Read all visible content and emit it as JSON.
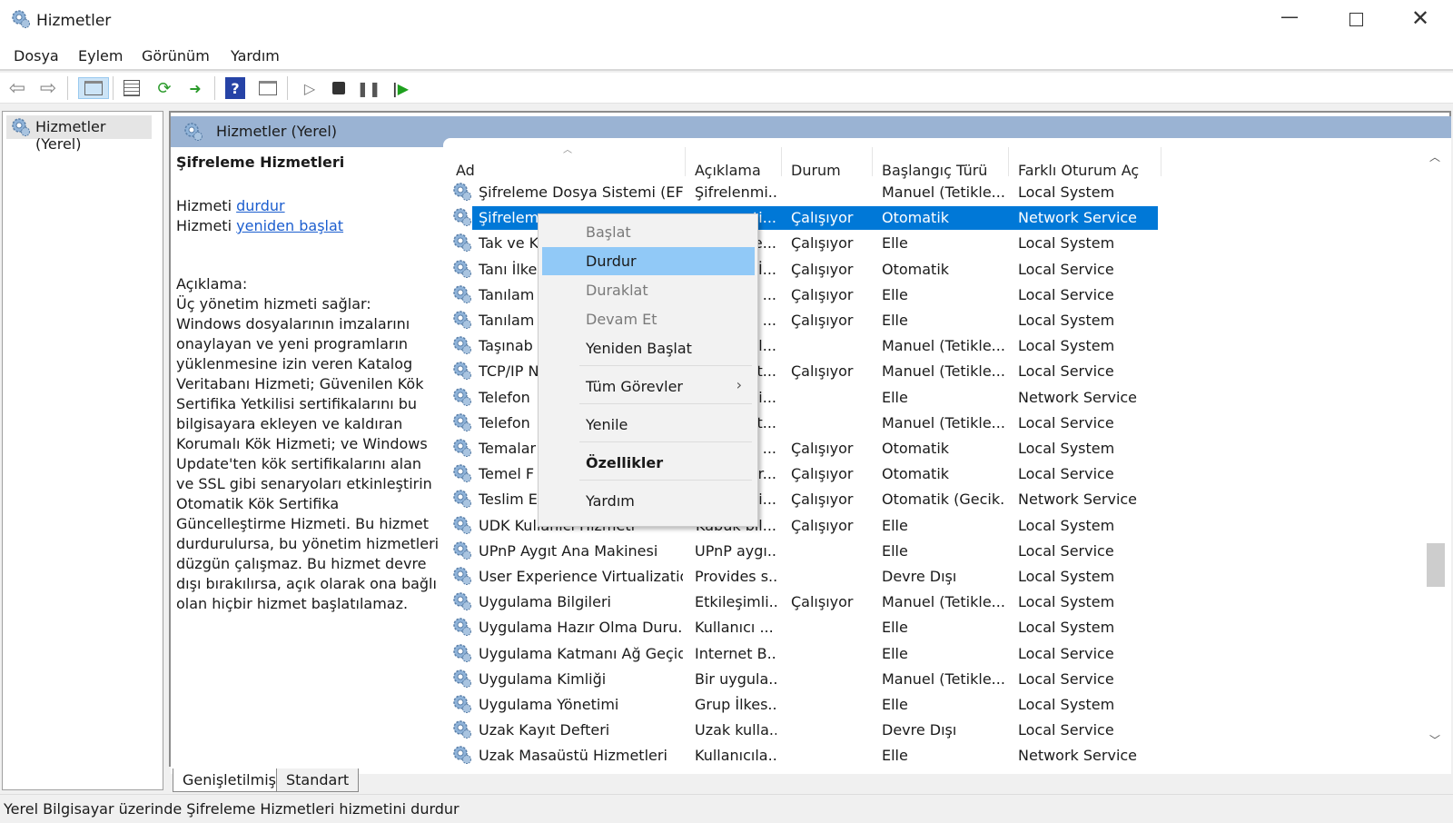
{
  "window": {
    "title": "Hizmetler",
    "icon": "gear-icon"
  },
  "menu": [
    "Dosya",
    "Eylem",
    "Görünüm",
    "Yardım"
  ],
  "toolbar": [
    "back-icon",
    "forward-icon",
    "show-hide-console-tree-icon",
    "properties-icon",
    "refresh-icon",
    "export-list-icon",
    "help-icon",
    "show-action-pane-icon",
    "start-service-icon",
    "stop-service-icon",
    "pause-service-icon",
    "restart-service-icon"
  ],
  "tree": {
    "item": "Hizmetler (Yerel)"
  },
  "header": {
    "title": "Hizmetler (Yerel)"
  },
  "details": {
    "title": "Şifreleme Hizmetleri",
    "prefix": "Hizmeti",
    "stop_link": "durdur",
    "restart_link": "yeniden başlat",
    "desc_label": "Açıklama:",
    "desc_text": "Üç yönetim hizmeti sağlar: Windows dosyalarının imzalarını onaylayan ve yeni programların yüklenmesine izin veren Katalog Veritabanı Hizmeti; Güvenilen Kök Sertifika Yetkilisi sertifikalarını bu bilgisayara ekleyen ve kaldıran Korumalı Kök Hizmeti; ve Windows Update'ten kök sertifikalarını alan ve SSL gibi senaryoları etkinleştirin Otomatik Kök Sertifika Güncelleştirme Hizmeti. Bu hizmet durdurulursa, bu yönetim hizmetleri düzgün çalışmaz. Bu hizmet devre dışı bırakılırsa, açık olarak ona bağlı olan hiçbir hizmet başlatılamaz."
  },
  "columns": [
    "Ad",
    "Açıklama",
    "Durum",
    "Başlangıç Türü",
    "Farklı Oturum Aç"
  ],
  "selected_color": "#0078d7",
  "rows": [
    [
      "Şifreleme Dosya Sistemi (EFS)",
      "Şifrelenmi...",
      "",
      "Manuel (Tetikle...",
      "Local System"
    ],
    [
      "Şifrelem",
      "eti...",
      "Çalışıyor",
      "Otomatik",
      "Network Service"
    ],
    [
      "Tak ve K",
      "ve...",
      "Çalışıyor",
      "Elle",
      "Local System"
    ],
    [
      "Tanı İlke",
      "a İ...",
      "Çalışıyor",
      "Otomatik",
      "Local Service"
    ],
    [
      "Tanılam",
      "a ...",
      "Çalışıyor",
      "Elle",
      "Local Service"
    ],
    [
      "Tanılam",
      "a ...",
      "Çalışıyor",
      "Elle",
      "Local System"
    ],
    [
      "Taşınab",
      "bil...",
      "",
      "Manuel (Tetikle...",
      "Local System"
    ],
    [
      "TCP/IP N",
      "ist...",
      "Çalışıyor",
      "Manuel (Tetikle...",
      "Local Service"
    ],
    [
      "Telefon",
      "gi...",
      "",
      "Elle",
      "Network Service"
    ],
    [
      "Telefon",
      "t...",
      "",
      "Manuel (Tetikle...",
      "Local Service"
    ],
    [
      "Temalar",
      "ı ...",
      "Çalışıyor",
      "Otomatik",
      "Local System"
    ],
    [
      "Temel F",
      "iltr...",
      "Çalışıyor",
      "Otomatik",
      "Local Service"
    ],
    [
      "Teslim E",
      "sli...",
      "Çalışıyor",
      "Otomatik (Gecik...",
      "Network Service"
    ],
    [
      "UDK Kullanıcı Hizmeti",
      "Kabuk bil...",
      "Çalışıyor",
      "Elle",
      "Local System"
    ],
    [
      "UPnP Aygıt Ana Makinesi",
      "UPnP aygı...",
      "",
      "Elle",
      "Local Service"
    ],
    [
      "User Experience Virtualizatio...",
      "Provides s...",
      "",
      "Devre Dışı",
      "Local System"
    ],
    [
      "Uygulama Bilgileri",
      "Etkileşimli...",
      "Çalışıyor",
      "Manuel (Tetikle...",
      "Local System"
    ],
    [
      "Uygulama Hazır Olma Duru...",
      "Kullanıcı ...",
      "",
      "Elle",
      "Local System"
    ],
    [
      "Uygulama Katmanı Ağ Geçid...",
      "Internet B...",
      "",
      "Elle",
      "Local Service"
    ],
    [
      "Uygulama Kimliği",
      "Bir uygula...",
      "",
      "Manuel (Tetikle...",
      "Local Service"
    ],
    [
      "Uygulama Yönetimi",
      "Grup İlkes...",
      "",
      "Elle",
      "Local System"
    ],
    [
      "Uzak Kayıt Defteri",
      "Uzak kulla...",
      "",
      "Devre Dışı",
      "Local Service"
    ],
    [
      "Uzak Masaüstü Hizmetleri",
      "Kullanıcıla...",
      "",
      "Elle",
      "Network Service"
    ]
  ],
  "selected_row": 1,
  "context_menu": [
    {
      "label": "Başlat",
      "state": "disabled"
    },
    {
      "label": "Durdur",
      "state": "highlighted"
    },
    {
      "label": "Duraklat",
      "state": "disabled"
    },
    {
      "label": "Devam Et",
      "state": "disabled"
    },
    {
      "label": "Yeniden Başlat",
      "state": "normal"
    },
    {
      "label": "Tüm Görevler",
      "state": "submenu"
    },
    {
      "label": "Yenile",
      "state": "normal"
    },
    {
      "label": "Özellikler",
      "state": "bold"
    },
    {
      "label": "Yardım",
      "state": "normal"
    }
  ],
  "tabs": [
    "Genişletilmiş",
    "Standart"
  ],
  "status": "Yerel Bilgisayar üzerinde Şifreleme Hizmetleri hizmetini durdur"
}
